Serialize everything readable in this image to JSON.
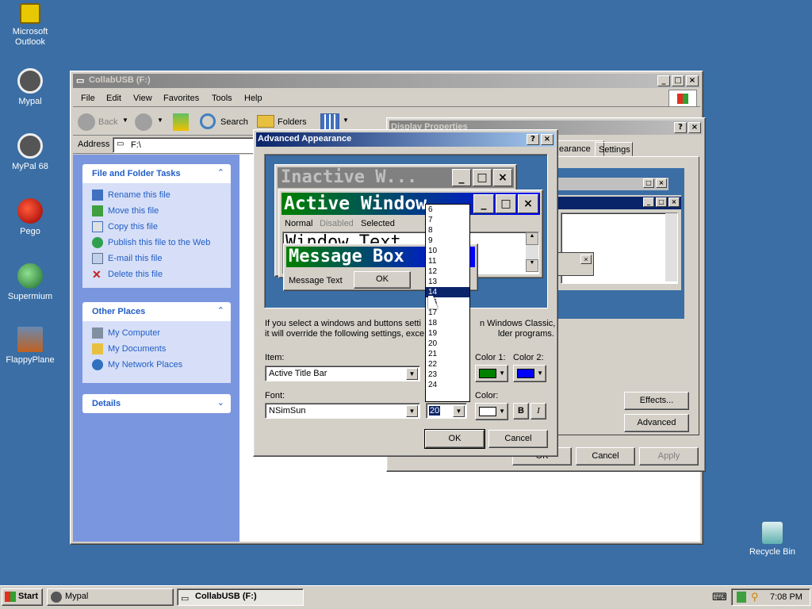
{
  "desktop": {
    "icons": [
      {
        "label": "Microsoft Outlook",
        "color": "#c8a000"
      },
      {
        "label": "Mypal",
        "color": "#555"
      },
      {
        "label": "MyPal 68",
        "color": "#555"
      },
      {
        "label": "Pego",
        "color": "#c01010"
      },
      {
        "label": "Supermium",
        "color": "#2a8a3a"
      },
      {
        "label": "FlappyPlane",
        "color": "#c06020"
      },
      {
        "label": "Recycle Bin",
        "color": "#2aa0a0"
      }
    ]
  },
  "explorer": {
    "title": "CollabUSB (F:)",
    "menu": [
      "File",
      "Edit",
      "View",
      "Favorites",
      "Tools",
      "Help"
    ],
    "toolbar": {
      "back": "Back",
      "search": "Search",
      "folders": "Folders"
    },
    "address_label": "Address",
    "address_value": "F:\\",
    "file_tasks": {
      "title": "File and Folder Tasks",
      "items": [
        "Rename this file",
        "Move this file",
        "Copy this file",
        "Publish this file to the Web",
        "E-mail this file",
        "Delete this file"
      ]
    },
    "other_places": {
      "title": "Other Places",
      "items": [
        "My Computer",
        "My Documents",
        "My Network Places"
      ]
    },
    "details": {
      "title": "Details"
    }
  },
  "display_props": {
    "title": "Display Properties",
    "tabs": [
      "earance",
      "Settings"
    ],
    "effects": "Effects...",
    "advanced": "Advanced",
    "ok": "OK",
    "cancel": "Cancel",
    "apply": "Apply"
  },
  "adv": {
    "title": "Advanced Appearance",
    "inactive": "Inactive W...",
    "active": "Active Window",
    "menu_normal": "Normal",
    "menu_disabled": "Disabled",
    "menu_selected": "Selected",
    "window_text": "Window Text",
    "message_box": "Message Box",
    "message_text": "Message Text",
    "msg_ok": "OK",
    "info_1": "If you select a windows and buttons setti",
    "info_1b": "n Windows Classic,",
    "info_2": "it will override the following settings, exce",
    "info_2b": "lder programs.",
    "item_label": "Item:",
    "item_value": "Active Title Bar",
    "color1": "Color 1:",
    "color2": "Color 2:",
    "font_label": "Font:",
    "font_value": "NSimSun",
    "size_value": "20",
    "color_label": "Color:",
    "bold": "B",
    "italic": "I",
    "ok": "OK",
    "cancel": "Cancel",
    "size_options": [
      "6",
      "7",
      "8",
      "9",
      "10",
      "11",
      "12",
      "13",
      "14",
      "16",
      "17",
      "18",
      "19",
      "20",
      "21",
      "22",
      "23",
      "24"
    ],
    "selected_size": "14",
    "color1_value": "#008000",
    "color2_value": "#0000ff"
  },
  "taskbar": {
    "start": "Start",
    "tasks": [
      "Mypal",
      "CollabUSB (F:)"
    ],
    "time": "7:08 PM"
  }
}
